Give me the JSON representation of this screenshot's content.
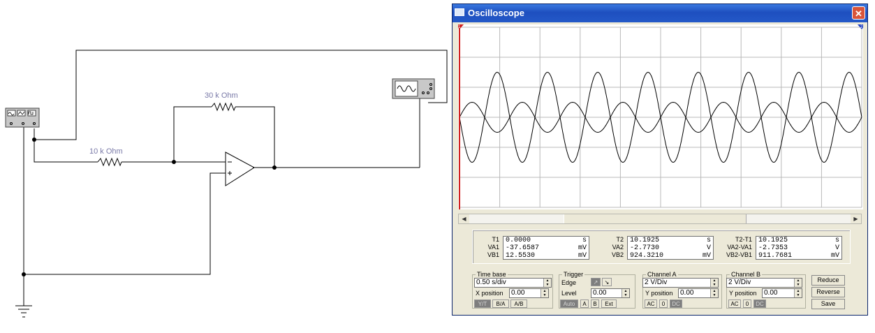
{
  "schematic": {
    "r_feedback_label": "30 k Ohm",
    "r_input_label": "10 k Ohm"
  },
  "scope": {
    "title": "Oscilloscope",
    "cursor_markers": [
      "1",
      "2"
    ],
    "readouts": [
      {
        "labels": [
          "T1",
          "VA1",
          "VB1"
        ],
        "values": [
          [
            "0.0000",
            "s"
          ],
          [
            "-37.6587",
            "mV"
          ],
          [
            "12.5530",
            "mV"
          ]
        ]
      },
      {
        "labels": [
          "T2",
          "VA2",
          "VB2"
        ],
        "values": [
          [
            "10.1925",
            "s"
          ],
          [
            "-2.7730",
            "V"
          ],
          [
            "924.3210",
            "mV"
          ]
        ]
      },
      {
        "labels": [
          "T2-T1",
          "VA2-VA1",
          "VB2-VB1"
        ],
        "values": [
          [
            "10.1925",
            "s"
          ],
          [
            "-2.7353",
            "V"
          ],
          [
            "911.7681",
            "mV"
          ]
        ]
      }
    ],
    "timebase": {
      "legend": "Time base",
      "scale": "0.50 s/div",
      "xpos_label": "X position",
      "xpos_value": "0.00",
      "modes": [
        "Y/T",
        "B/A",
        "A/B"
      ],
      "active_mode": "Y/T"
    },
    "trigger": {
      "legend": "Trigger",
      "edge_label": "Edge",
      "level_label": "Level",
      "level_value": "0.00",
      "sources": [
        "Auto",
        "A",
        "B",
        "Ext"
      ],
      "active_source": "Auto"
    },
    "channel_a": {
      "legend": "Channel A",
      "scale": "2 V/Div",
      "ypos_label": "Y position",
      "ypos_value": "0.00",
      "coupling": [
        "AC",
        "0",
        "DC"
      ],
      "active": "DC"
    },
    "channel_b": {
      "legend": "Channel B",
      "scale": "2 V/Div",
      "ypos_label": "Y position",
      "ypos_value": "0.00",
      "coupling": [
        "AC",
        "0",
        "DC"
      ],
      "active": "DC"
    },
    "buttons": {
      "reduce": "Reduce",
      "reverse": "Reverse",
      "save": "Save"
    }
  },
  "chart_data": {
    "type": "line",
    "title": "",
    "xlabel": "",
    "ylabel": "",
    "grid": true,
    "x_divisions": 10,
    "y_divisions": 6,
    "time_per_div_s": 0.5,
    "volts_per_div": 2,
    "series": [
      {
        "name": "Channel A",
        "waveform": "sine",
        "amplitude_v": 3.0,
        "period_s": 0.625,
        "phase": "inverted",
        "color": "#000000"
      },
      {
        "name": "Channel B",
        "waveform": "sine",
        "amplitude_v": 1.0,
        "period_s": 0.625,
        "phase": "normal",
        "color": "#000000"
      }
    ]
  }
}
